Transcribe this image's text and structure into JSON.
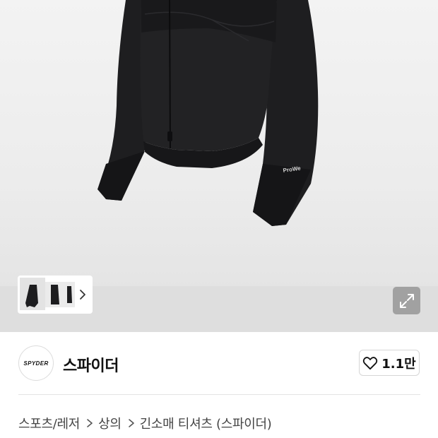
{
  "product_image": {
    "print_text": "ProWe",
    "thumbnail_count": 3,
    "thumb_next_icon": "chevron-right-icon",
    "expand_icon": "expand-arrows-icon"
  },
  "brand": {
    "logo_text": "SPYDER",
    "name": "스파이더"
  },
  "like": {
    "icon": "heart-icon",
    "count": "1.1만"
  },
  "breadcrumb": [
    {
      "label": "스포츠/레저"
    },
    {
      "label": "상의"
    },
    {
      "label": "긴소매 티셔츠 (스파이더)"
    }
  ],
  "colors": {
    "background": "#ffffff",
    "image_bg": "#ececec",
    "jacket": "#1c1c1e",
    "text": "#111111",
    "muted_text": "#444444",
    "border": "#d6d6d6"
  }
}
